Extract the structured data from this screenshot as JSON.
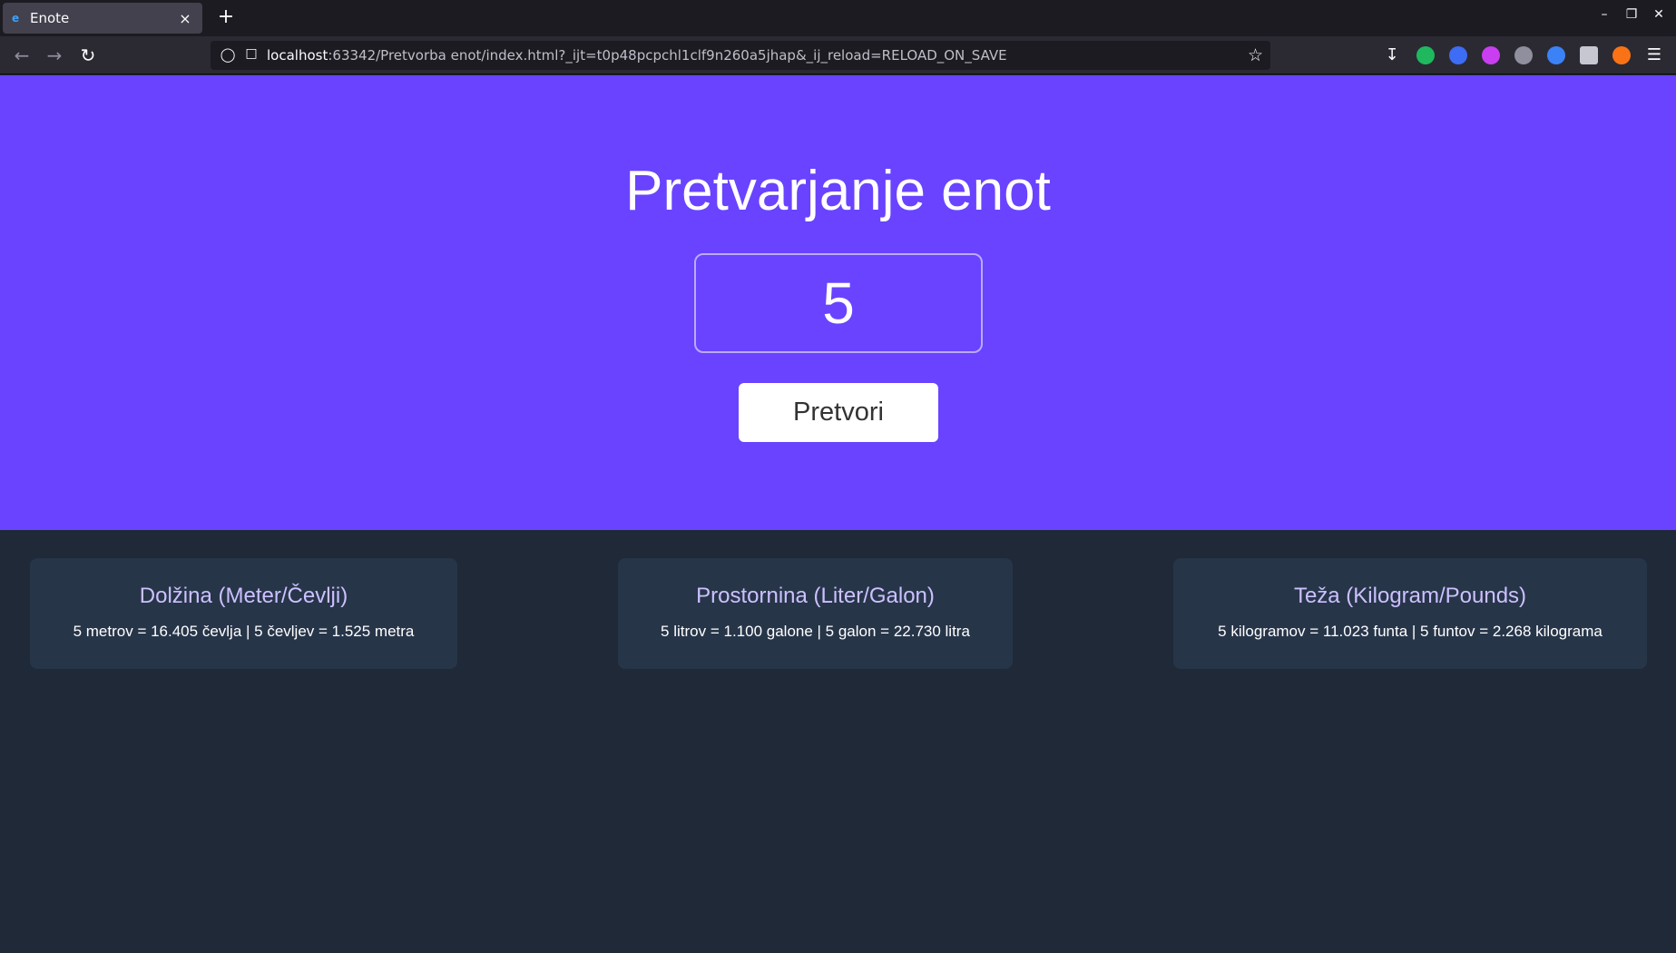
{
  "browser": {
    "tab_title": "Enote",
    "tab_close": "×",
    "new_tab": "+",
    "url_host": "localhost",
    "url_rest": ":63342/Pretvorba enot/index.html?_ijt=t0p48pcpchl1clf9n260a5jhap&_ij_reload=RELOAD_ON_SAVE",
    "icons": [
      "back-icon",
      "forward-icon",
      "reload-icon",
      "shield-icon",
      "page-icon",
      "bookmark-star-icon",
      "download-icon",
      "menu-icon"
    ],
    "extension_colors": [
      "#1fb85f",
      "#3d6cf5",
      "#c83ef0",
      "#8f8f9d",
      "#3b82f6",
      "#c7c7d1",
      "#f97316"
    ]
  },
  "page": {
    "title": "Pretvarjanje enot",
    "input_value": "5",
    "button_label": "Pretvori",
    "colors": {
      "hero": "#6943ff",
      "background": "#1f2937",
      "card": "#273549",
      "card_title": "#ccc1ff"
    }
  },
  "cards": [
    {
      "title": "Dolžina (Meter/Čevlji)",
      "text": "5 metrov = 16.405 čevlja | 5 čevljev = 1.525 metra"
    },
    {
      "title": "Prostornina (Liter/Galon)",
      "text": "5 litrov = 1.100 galone | 5 galon = 22.730 litra"
    },
    {
      "title": "Teža (Kilogram/Pounds)",
      "text": "5 kilogramov = 11.023 funta | 5 funtov = 2.268 kilograma"
    }
  ]
}
